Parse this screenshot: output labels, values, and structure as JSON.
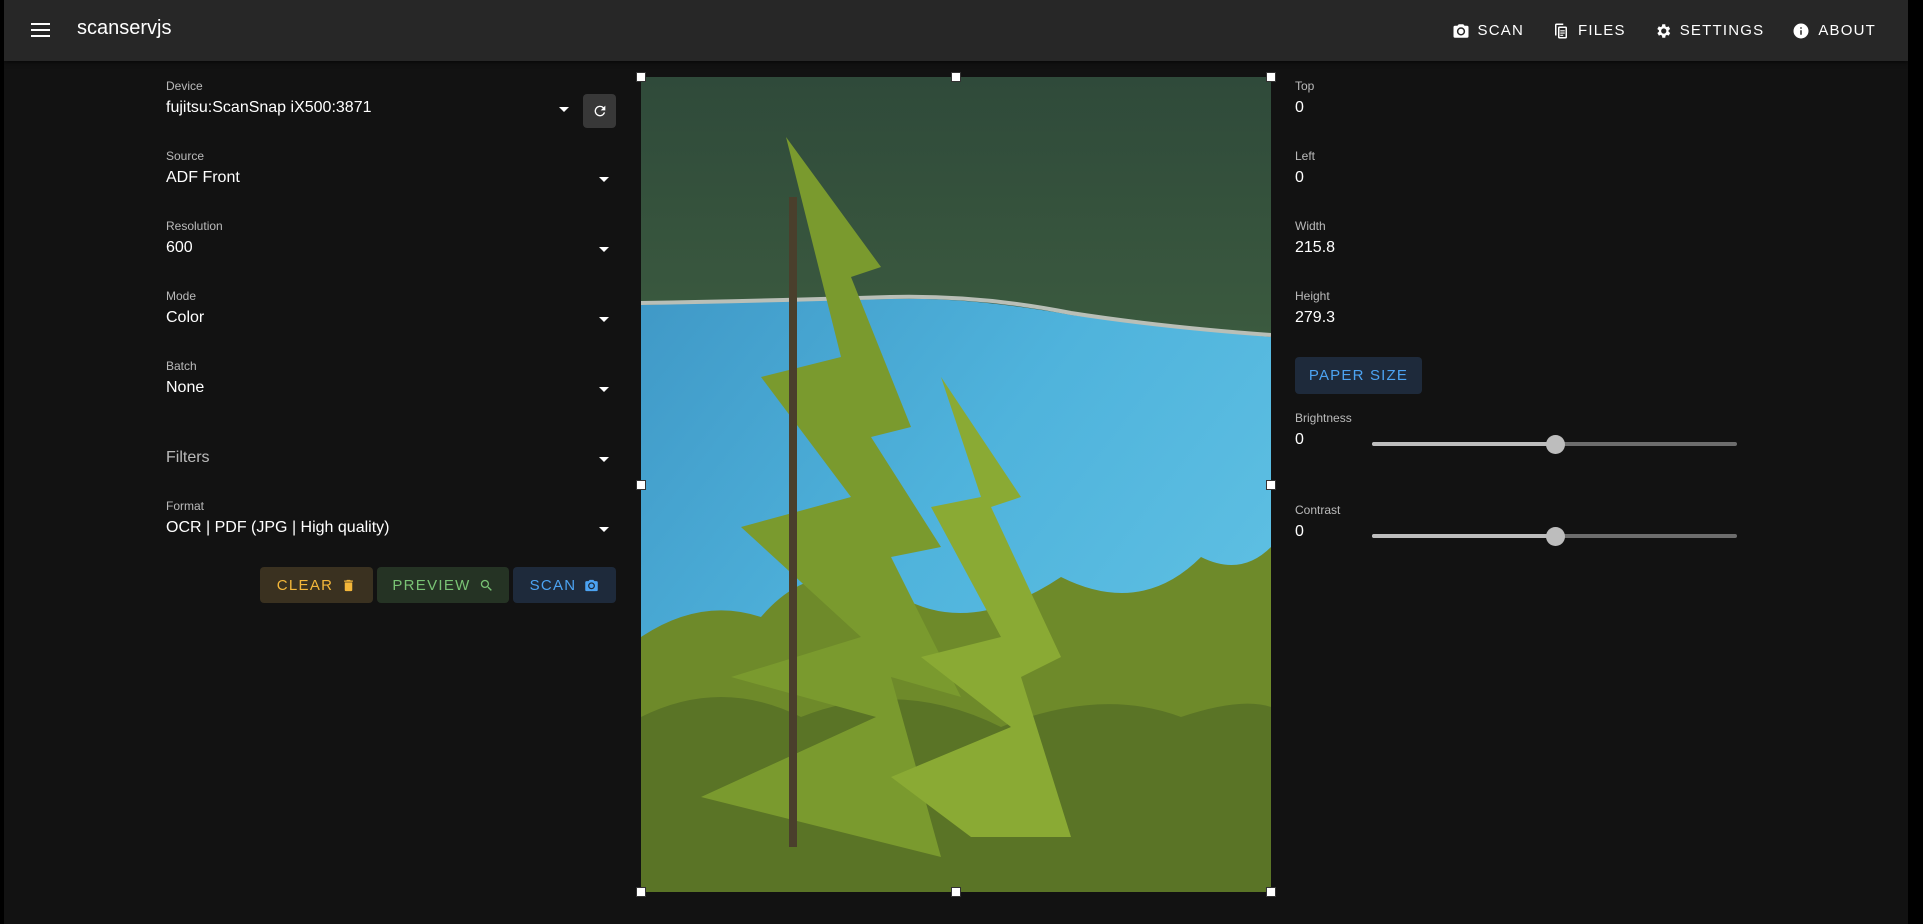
{
  "app": {
    "title": "scanservjs",
    "nav": [
      {
        "label": "SCAN",
        "icon": "camera-icon"
      },
      {
        "label": "FILES",
        "icon": "files-icon"
      },
      {
        "label": "SETTINGS",
        "icon": "gear-icon"
      },
      {
        "label": "ABOUT",
        "icon": "info-icon"
      }
    ]
  },
  "form": {
    "device": {
      "label": "Device",
      "value": "fujitsu:ScanSnap iX500:3871"
    },
    "source": {
      "label": "Source",
      "value": "ADF Front"
    },
    "resolution": {
      "label": "Resolution",
      "value": "600"
    },
    "mode": {
      "label": "Mode",
      "value": "Color"
    },
    "batch": {
      "label": "Batch",
      "value": "None"
    },
    "filters": {
      "label": "Filters"
    },
    "format": {
      "label": "Format",
      "value": "OCR | PDF (JPG | High quality)"
    }
  },
  "actions": {
    "clear": "CLEAR",
    "preview": "PREVIEW",
    "scan": "SCAN"
  },
  "geometry": {
    "top": {
      "label": "Top",
      "value": "0"
    },
    "left": {
      "label": "Left",
      "value": "0"
    },
    "width": {
      "label": "Width",
      "value": "215.8"
    },
    "height": {
      "label": "Height",
      "value": "279.3"
    },
    "paper_size": "PAPER SIZE"
  },
  "adjustments": {
    "brightness": {
      "label": "Brightness",
      "value": "0",
      "position": 0.5
    },
    "contrast": {
      "label": "Contrast",
      "value": "0",
      "position": 0.5
    }
  },
  "colors": {
    "clear": "#f4b73a",
    "preview": "#79c374",
    "scan": "#4ca3f2",
    "appbar": "#272727",
    "background": "#121212"
  }
}
